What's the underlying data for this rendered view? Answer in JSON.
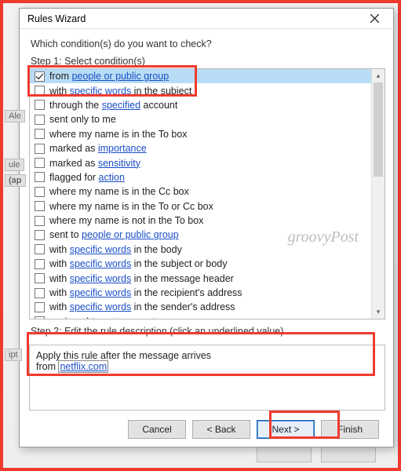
{
  "dialog": {
    "title": "Rules Wizard",
    "prompt": "Which condition(s) do you want to check?",
    "step1_label": "Step 1: Select condition(s)",
    "step2_label": "Step 2: Edit the rule description (click an underlined value)"
  },
  "conditions": {
    "c0": {
      "pre": "from ",
      "link": "people or public group",
      "post": ""
    },
    "c1": {
      "pre": "with ",
      "link": "specific words",
      "post": " in the subject"
    },
    "c2": {
      "pre": "through the ",
      "link": "specified",
      "post": " account"
    },
    "c3": {
      "pre": "sent only to me",
      "link": "",
      "post": ""
    },
    "c4": {
      "pre": "where my name is in the To box",
      "link": "",
      "post": ""
    },
    "c5": {
      "pre": "marked as ",
      "link": "importance",
      "post": ""
    },
    "c6": {
      "pre": "marked as ",
      "link": "sensitivity",
      "post": ""
    },
    "c7": {
      "pre": "flagged for ",
      "link": "action",
      "post": ""
    },
    "c8": {
      "pre": "where my name is in the Cc box",
      "link": "",
      "post": ""
    },
    "c9": {
      "pre": "where my name is in the To or Cc box",
      "link": "",
      "post": ""
    },
    "c10": {
      "pre": "where my name is not in the To box",
      "link": "",
      "post": ""
    },
    "c11": {
      "pre": "sent to ",
      "link": "people or public group",
      "post": ""
    },
    "c12": {
      "pre": "with ",
      "link": "specific words",
      "post": " in the body"
    },
    "c13": {
      "pre": "with ",
      "link": "specific words",
      "post": " in the subject or body"
    },
    "c14": {
      "pre": "with ",
      "link": "specific words",
      "post": " in the message header"
    },
    "c15": {
      "pre": "with ",
      "link": "specific words",
      "post": " in the recipient's address"
    },
    "c16": {
      "pre": "with ",
      "link": "specific words",
      "post": " in the sender's address"
    },
    "c17": {
      "pre": "assigned to ",
      "link": "category",
      "post": " category"
    }
  },
  "description": {
    "line1": "Apply this rule after the message arrives",
    "line2_pre": "from ",
    "line2_link": "netflix.com"
  },
  "buttons": {
    "cancel": "Cancel",
    "back": "< Back",
    "next": "Next >",
    "finish": "Finish"
  },
  "side": {
    "ale": "Ale",
    "ule": "ule",
    "ap": "(ap",
    "ipt": "ipt"
  },
  "watermark": "groovyPost"
}
